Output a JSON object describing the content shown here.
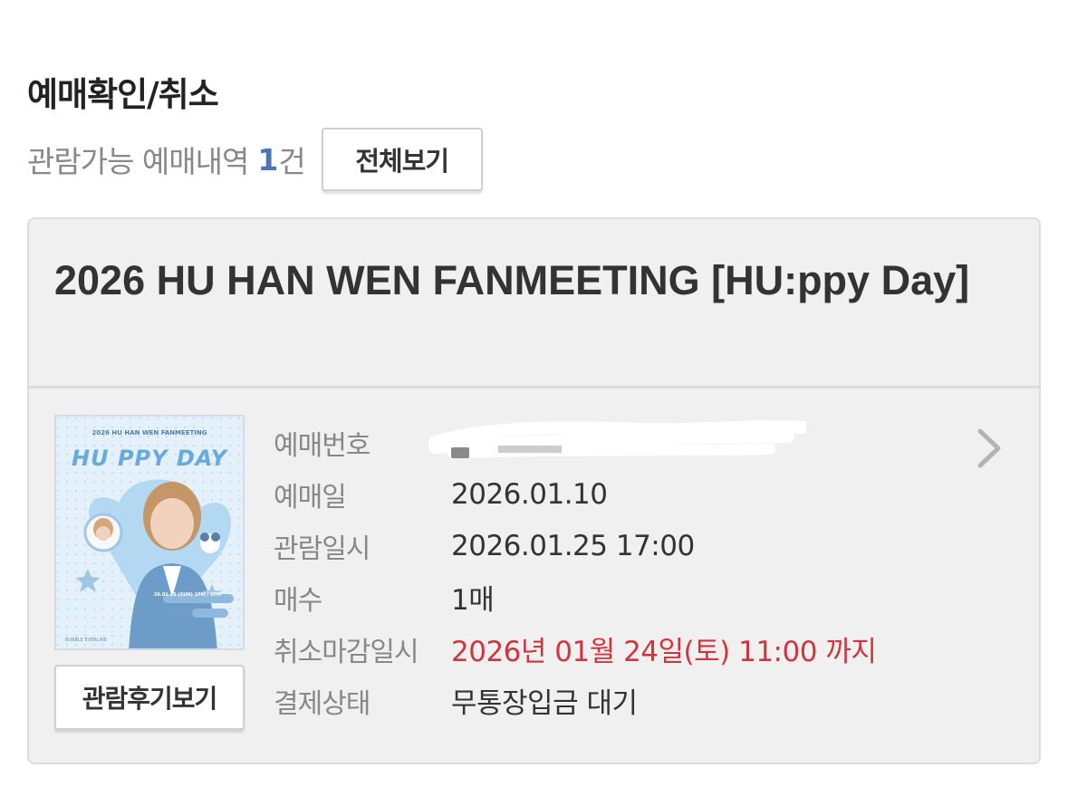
{
  "header": {
    "title": "예매확인/취소",
    "summary_text": "관람가능 예매내역",
    "summary_count": "1",
    "summary_unit": "건",
    "view_all_label": "전체보기"
  },
  "booking": {
    "title": "2026 HU HAN WEN FANMEETING [HU:ppy Day]",
    "poster": {
      "top_text": "2026 HU HAN WEN FANMEETING",
      "logo_text": "HU PPY DAY",
      "date_text": "26.01.25 (SUN) 1PM / 5PM",
      "footer_text": "BUBBLE EVERLINE"
    },
    "review_button_label": "관람후기보기",
    "details": [
      {
        "label": "예매번호",
        "value": ""
      },
      {
        "label": "예매일",
        "value": "2026.01.10"
      },
      {
        "label": "관람일시",
        "value": "2026.01.25 17:00"
      },
      {
        "label": "매수",
        "value": "1매"
      },
      {
        "label": "취소마감일시",
        "value": "2026년 01월 24일(토) 11:00 까지"
      },
      {
        "label": "결제상태",
        "value": "무통장입금 대기"
      }
    ]
  },
  "colors": {
    "accent_blue": "#4a78b5",
    "deadline_red": "#d0343d",
    "card_bg": "#f0f0f0"
  },
  "icons": {
    "detail_arrow": "chevron-right-icon",
    "redaction": "redaction-scribble"
  }
}
